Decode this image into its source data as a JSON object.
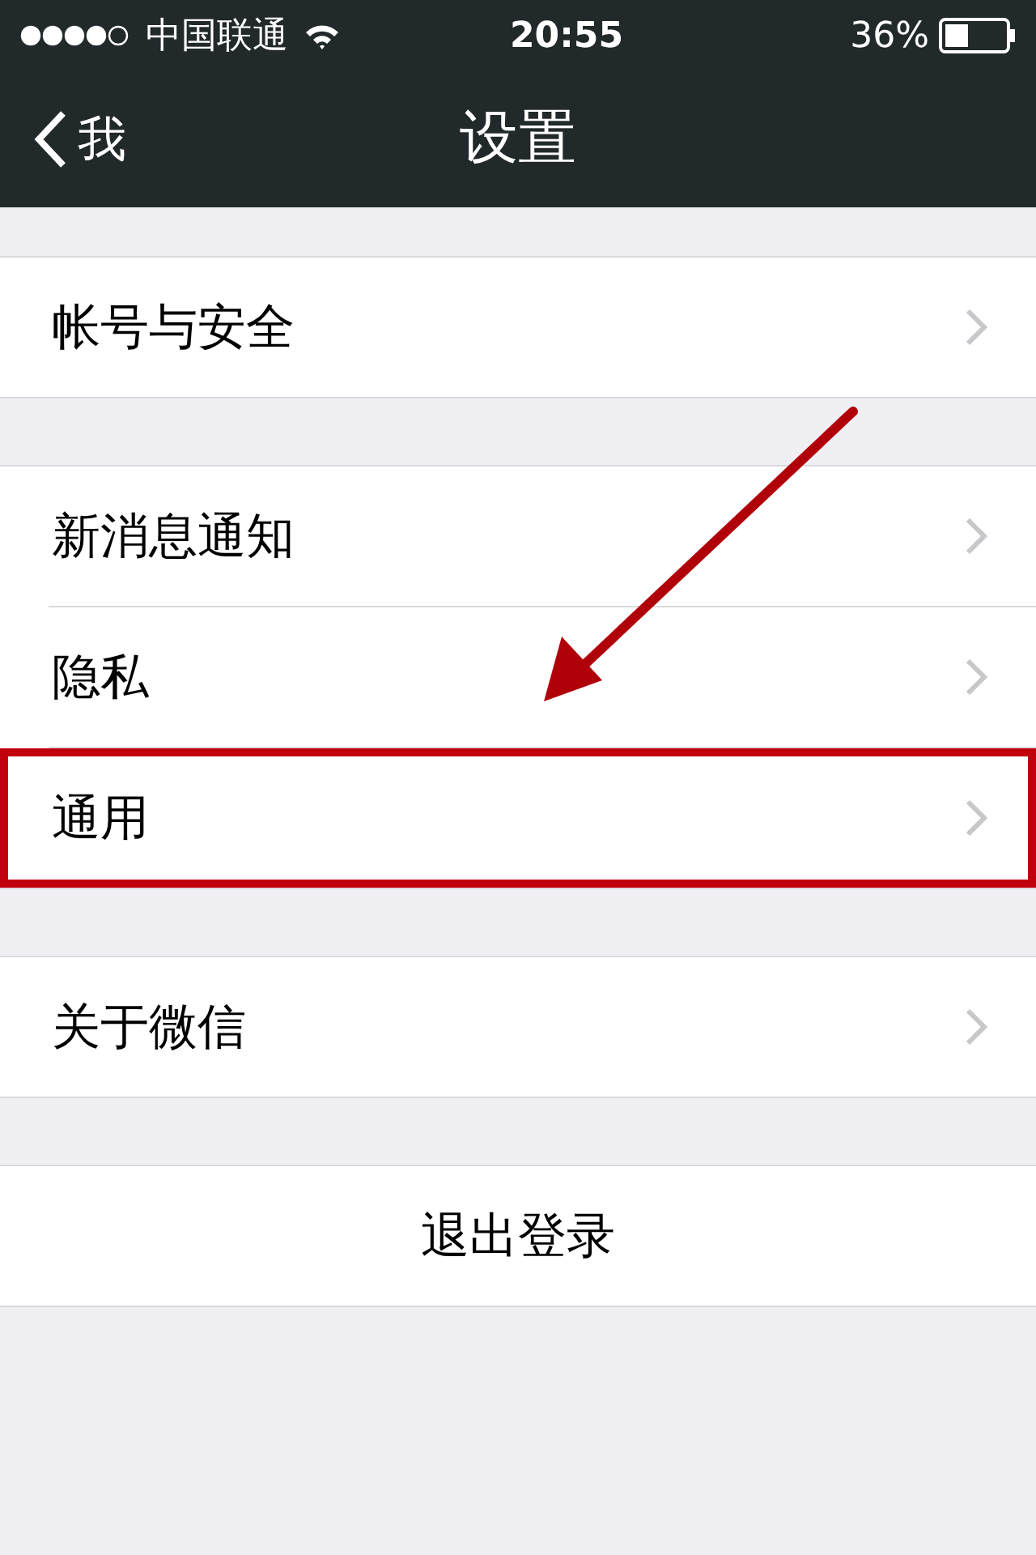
{
  "status_bar": {
    "carrier": "中国联通",
    "time": "20:55",
    "battery": "36%"
  },
  "nav": {
    "back": "我",
    "title": "设置"
  },
  "groups": [
    {
      "rows": [
        {
          "label": "帐号与安全",
          "highlighted": false
        }
      ]
    },
    {
      "rows": [
        {
          "label": "新消息通知",
          "highlighted": false
        },
        {
          "label": "隐私",
          "highlighted": false
        },
        {
          "label": "通用",
          "highlighted": true
        }
      ]
    },
    {
      "rows": [
        {
          "label": "关于微信",
          "highlighted": false
        }
      ]
    }
  ],
  "logout": "退出登录"
}
